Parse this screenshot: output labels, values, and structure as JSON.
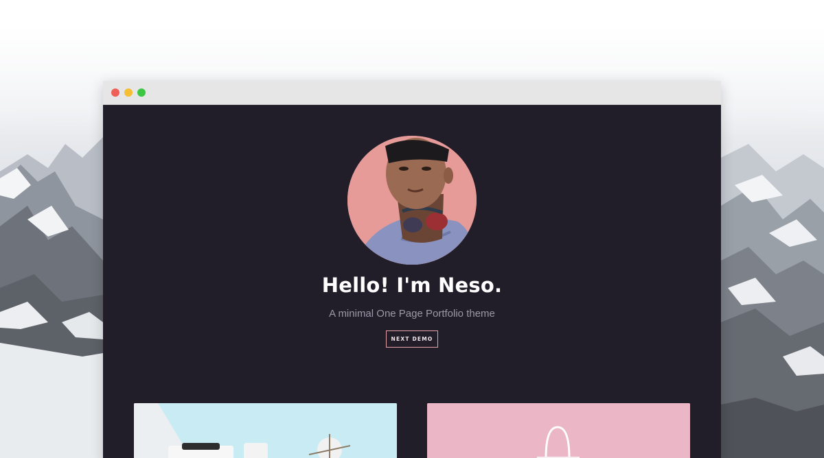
{
  "hero": {
    "title": "Hello! I'm Neso.",
    "subtitle": "A minimal One Page Portfolio theme",
    "cta_label": "NEXT DEMO"
  },
  "colors": {
    "page_background": "#211d29",
    "accent_pink": "#e6a2a6",
    "titlebar": "#e6e6e6"
  },
  "portfolio": {
    "items": [
      {
        "name": "workspace-still-life"
      },
      {
        "name": "pink-shopping-bag"
      }
    ]
  }
}
